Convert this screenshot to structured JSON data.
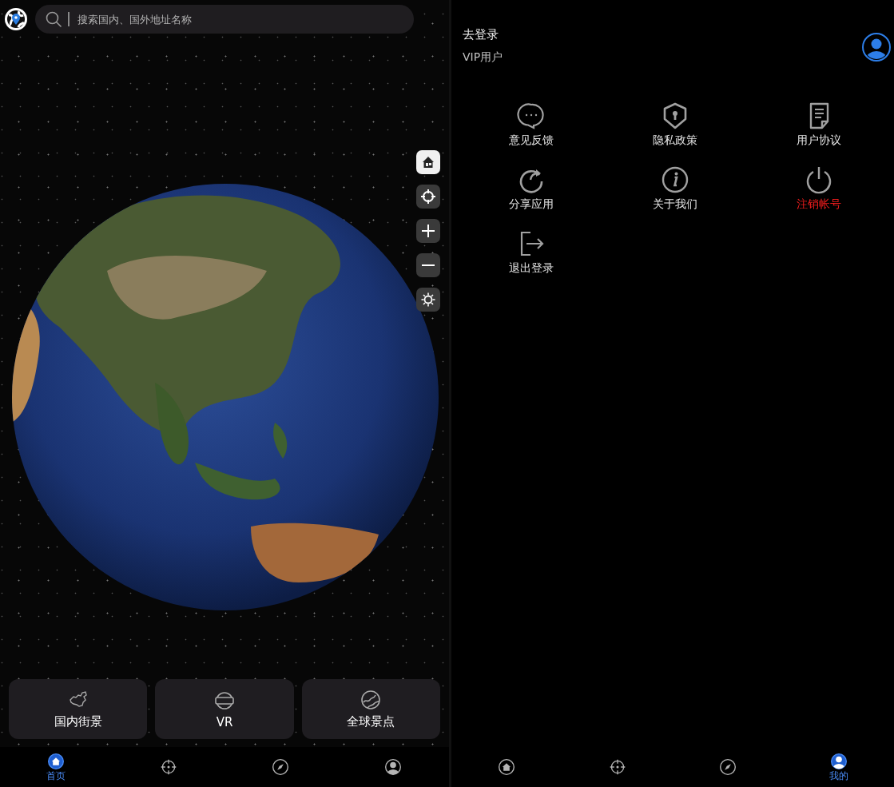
{
  "globe_screen": {
    "search": {
      "placeholder": "搜索国内、国外地址名称"
    },
    "map_controls": [
      {
        "kind": "home",
        "selected": true
      },
      {
        "kind": "locate",
        "selected": false
      },
      {
        "kind": "zoom_in",
        "selected": false
      },
      {
        "kind": "zoom_out",
        "selected": false
      },
      {
        "kind": "brightness",
        "selected": false
      }
    ],
    "cards": [
      {
        "kind": "china",
        "label": "国内街景"
      },
      {
        "kind": "vr",
        "label": "VR"
      },
      {
        "kind": "globe",
        "label": "全球景点"
      }
    ],
    "tab_bar": [
      {
        "kind": "home",
        "label": "首页",
        "selected": true
      },
      {
        "kind": "locate",
        "selected": false
      },
      {
        "kind": "compass",
        "selected": false
      },
      {
        "kind": "profile",
        "selected": false
      }
    ]
  },
  "profile_screen": {
    "login": "去登录",
    "membership": "VIP用户",
    "menu": [
      {
        "kind": "feedback",
        "label": "意见反馈",
        "danger": false
      },
      {
        "kind": "privacy",
        "label": "隐私政策",
        "danger": false
      },
      {
        "kind": "agreement",
        "label": "用户协议",
        "danger": false
      },
      {
        "kind": "share",
        "label": "分享应用",
        "danger": false
      },
      {
        "kind": "about",
        "label": "关于我们",
        "danger": false
      },
      {
        "kind": "power",
        "label": "注销帐号",
        "danger": true
      },
      {
        "kind": "logout",
        "label": "退出登录",
        "danger": false
      }
    ],
    "tab_bar": [
      {
        "kind": "home",
        "selected": false
      },
      {
        "kind": "locate",
        "selected": false
      },
      {
        "kind": "compass",
        "selected": false
      },
      {
        "kind": "profile",
        "label": "我的",
        "selected": true
      }
    ]
  }
}
